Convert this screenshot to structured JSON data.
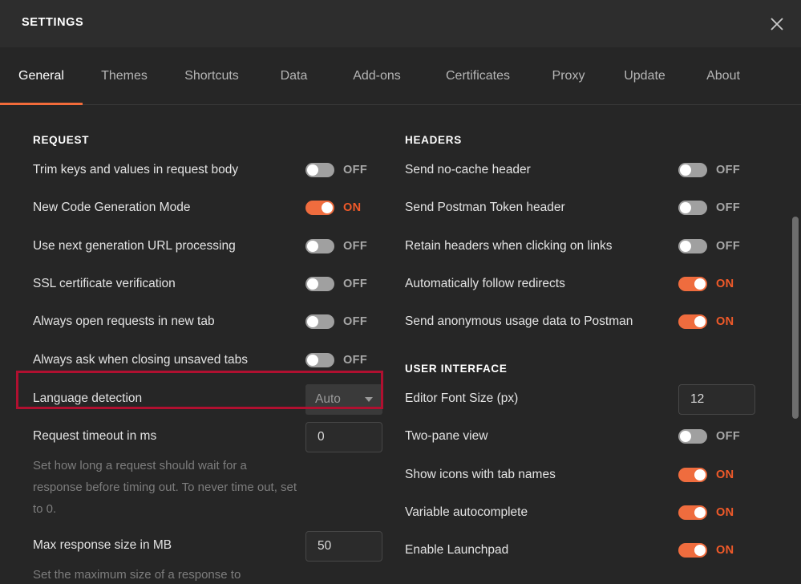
{
  "window": {
    "title": "SETTINGS",
    "close_icon": "close-icon"
  },
  "tabs": [
    {
      "label": "General",
      "active": true
    },
    {
      "label": "Themes",
      "active": false
    },
    {
      "label": "Shortcuts",
      "active": false
    },
    {
      "label": "Data",
      "active": false
    },
    {
      "label": "Add-ons",
      "active": false
    },
    {
      "label": "Certificates",
      "active": false
    },
    {
      "label": "Proxy",
      "active": false
    },
    {
      "label": "Update",
      "active": false
    },
    {
      "label": "About",
      "active": false
    }
  ],
  "colors": {
    "accent": "#f15a29",
    "toggle_on": "#ef6c3e",
    "toggle_off": "#a0a0a0",
    "highlight_border": "#b01030",
    "background": "#262626",
    "titlebar": "#2d2d2d"
  },
  "left_column": {
    "section_title": "REQUEST",
    "rows": [
      {
        "label": "Trim keys and values in request body",
        "type": "toggle",
        "state": "OFF"
      },
      {
        "label": "New Code Generation Mode",
        "type": "toggle",
        "state": "ON"
      },
      {
        "label": "Use next generation URL processing",
        "type": "toggle",
        "state": "OFF"
      },
      {
        "label": "SSL certificate verification",
        "type": "toggle",
        "state": "OFF",
        "highlighted": true
      },
      {
        "label": "Always open requests in new tab",
        "type": "toggle",
        "state": "OFF"
      },
      {
        "label": "Always ask when closing unsaved tabs",
        "type": "toggle",
        "state": "OFF"
      },
      {
        "label": "Language detection",
        "type": "dropdown",
        "value": "Auto"
      },
      {
        "label": "Request timeout in ms",
        "type": "textbox",
        "value": "0",
        "description": "Set how long a request should wait for a response before timing out. To never time out, set to 0."
      },
      {
        "label": "Max response size in MB",
        "type": "textbox",
        "value": "50",
        "description": "Set the maximum size of a response to"
      }
    ]
  },
  "right_column": {
    "sections": [
      {
        "section_title": "HEADERS",
        "rows": [
          {
            "label": "Send no-cache header",
            "type": "toggle",
            "state": "OFF"
          },
          {
            "label": "Send Postman Token header",
            "type": "toggle",
            "state": "OFF"
          },
          {
            "label": "Retain headers when clicking on links",
            "type": "toggle",
            "state": "OFF"
          },
          {
            "label": "Automatically follow redirects",
            "type": "toggle",
            "state": "ON"
          },
          {
            "label": "Send anonymous usage data to Postman",
            "type": "toggle",
            "state": "ON"
          }
        ]
      },
      {
        "section_title": "USER INTERFACE",
        "rows": [
          {
            "label": "Editor Font Size (px)",
            "type": "textbox",
            "value": "12"
          },
          {
            "label": "Two-pane view",
            "type": "toggle",
            "state": "OFF"
          },
          {
            "label": "Show icons with tab names",
            "type": "toggle",
            "state": "ON"
          },
          {
            "label": "Variable autocomplete",
            "type": "toggle",
            "state": "ON"
          },
          {
            "label": "Enable Launchpad",
            "type": "toggle",
            "state": "ON"
          }
        ]
      }
    ]
  }
}
